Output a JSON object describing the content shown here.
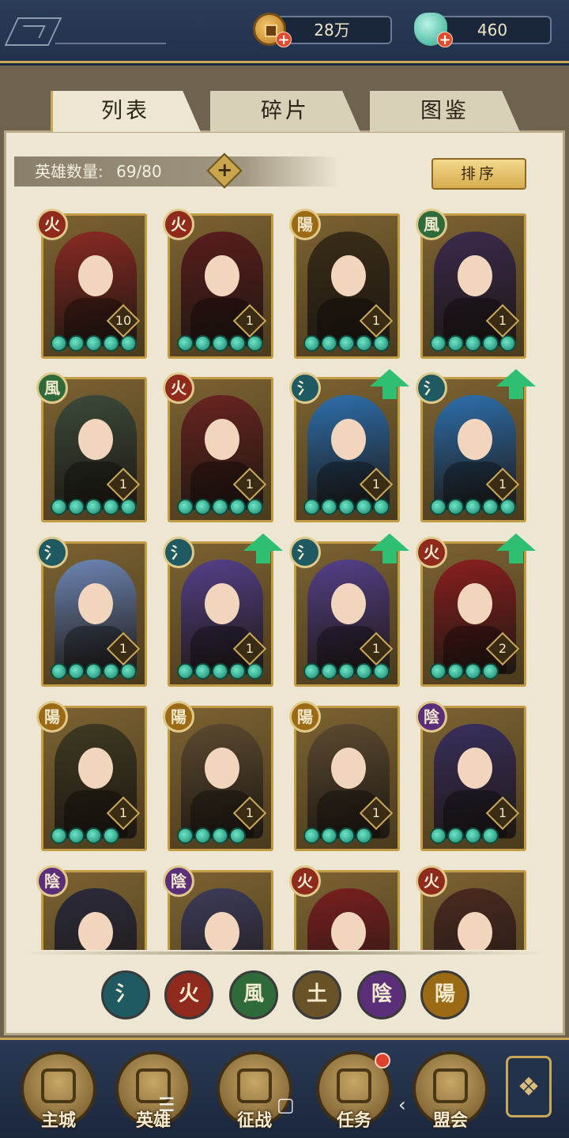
{
  "currency": {
    "coins": "28万",
    "jade": "460"
  },
  "tabs": [
    {
      "label": "列表",
      "active": true
    },
    {
      "label": "碎片",
      "active": false
    },
    {
      "label": "图鉴",
      "active": false
    }
  ],
  "hero_count": {
    "label": "英雄数量:",
    "value": "69/80"
  },
  "sort_label": "排序",
  "element_colors": {
    "水": "#1f5a62",
    "火": "#8f2a1c",
    "风": "#2f6a3b",
    "土": "#6a5228",
    "阴": "#5a2e78",
    "阳": "#9a6a14"
  },
  "element_glyphs": {
    "水": "氵",
    "火": "火",
    "风": "風",
    "土": "土",
    "阴": "陰",
    "阳": "陽"
  },
  "heroes": [
    {
      "element": "火",
      "level": "10",
      "stars": 5,
      "upgrade": false,
      "palette": "#8a2a22"
    },
    {
      "element": "火",
      "level": "1",
      "stars": 5,
      "upgrade": false,
      "palette": "#5a1d1d"
    },
    {
      "element": "阳",
      "level": "1",
      "stars": 5,
      "upgrade": false,
      "palette": "#3a2d18"
    },
    {
      "element": "风",
      "level": "1",
      "stars": 5,
      "upgrade": false,
      "palette": "#3b2a4e"
    },
    {
      "element": "风",
      "level": "1",
      "stars": 5,
      "upgrade": false,
      "palette": "#3b4a3a"
    },
    {
      "element": "火",
      "level": "1",
      "stars": 5,
      "upgrade": false,
      "palette": "#6a2420"
    },
    {
      "element": "水",
      "level": "1",
      "stars": 5,
      "upgrade": true,
      "palette": "#2d6fae"
    },
    {
      "element": "水",
      "level": "1",
      "stars": 5,
      "upgrade": true,
      "palette": "#2d6fae"
    },
    {
      "element": "水",
      "level": "1",
      "stars": 5,
      "upgrade": false,
      "palette": "#6d86b5"
    },
    {
      "element": "水",
      "level": "1",
      "stars": 5,
      "upgrade": true,
      "palette": "#54408a"
    },
    {
      "element": "水",
      "level": "1",
      "stars": 5,
      "upgrade": true,
      "palette": "#54408a"
    },
    {
      "element": "火",
      "level": "2",
      "stars": 4,
      "upgrade": true,
      "palette": "#8a1f1f"
    },
    {
      "element": "阳",
      "level": "1",
      "stars": 4,
      "upgrade": false,
      "palette": "#3f3a22"
    },
    {
      "element": "阳",
      "level": "1",
      "stars": 4,
      "upgrade": false,
      "palette": "#5b4a30"
    },
    {
      "element": "阳",
      "level": "1",
      "stars": 4,
      "upgrade": false,
      "palette": "#5b4a30"
    },
    {
      "element": "阴",
      "level": "1",
      "stars": 4,
      "upgrade": false,
      "palette": "#3a2f5e"
    },
    {
      "element": "阴",
      "level": "",
      "stars": 0,
      "upgrade": false,
      "palette": "#2b2b3a"
    },
    {
      "element": "阴",
      "level": "",
      "stars": 0,
      "upgrade": false,
      "palette": "#3c3c5a"
    },
    {
      "element": "火",
      "level": "",
      "stars": 0,
      "upgrade": false,
      "palette": "#7a1f1f"
    },
    {
      "element": "火",
      "level": "",
      "stars": 0,
      "upgrade": false,
      "palette": "#4a2a22"
    }
  ],
  "filters": [
    "水",
    "火",
    "风",
    "土",
    "阴",
    "阳"
  ],
  "nav": [
    {
      "label": "主城",
      "icon": "castle-icon"
    },
    {
      "label": "英雄",
      "icon": "hero-icon"
    },
    {
      "label": "征战",
      "icon": "battle-icon"
    },
    {
      "label": "任务",
      "icon": "quest-icon",
      "alert": true
    },
    {
      "label": "盟会",
      "icon": "guild-icon"
    }
  ],
  "system_nav": [
    "☰",
    "▢",
    "‹"
  ]
}
